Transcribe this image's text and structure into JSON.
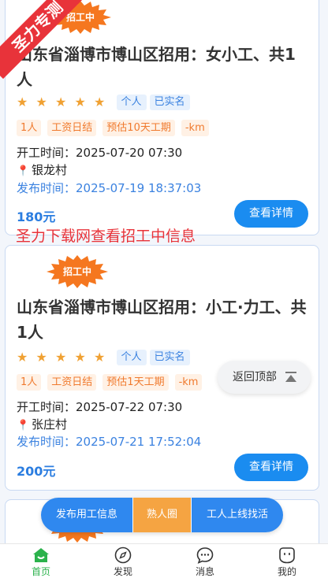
{
  "watermark_corner": "圣力专测",
  "watermark_line": "圣力下载网查看招工中信息",
  "jobs": [
    {
      "badge": "招工中",
      "title": "山东省淄博市博山区招用：女小工、共1人",
      "rating": 5,
      "badges": [
        "个人",
        "已实名"
      ],
      "tags": [
        "1人",
        "工资日结",
        "预估10天工期",
        "-km"
      ],
      "start_label": "开工时间：",
      "start_time": "2025-07-20   07:30",
      "location": "银龙村",
      "publish_label": "发布时间：",
      "publish_time": "2025-07-19   18:37:03",
      "price": "180元",
      "detail_button": "查看详情"
    },
    {
      "badge": "招工中",
      "title": "山东省淄博市博山区招用：小工·力工、共1人",
      "rating": 5,
      "badges": [
        "个人",
        "已实名"
      ],
      "tags": [
        "1人",
        "工资日结",
        "预估1天工期",
        "-km"
      ],
      "start_label": "开工时间：",
      "start_time": "2025-07-22   07:30",
      "location": "张庄村",
      "publish_label": "发布时间：",
      "publish_time": "2025-07-21   17:52:04",
      "price": "200元",
      "detail_button": "查看详情"
    }
  ],
  "back_to_top": "返回顶部",
  "actions": {
    "post": "发布用工信息",
    "acquaintance": "熟人圈",
    "worker_online": "工人上线找活"
  },
  "tabs": [
    {
      "label": "首页",
      "icon": "home-icon",
      "active": true
    },
    {
      "label": "发现",
      "icon": "compass-icon",
      "active": false
    },
    {
      "label": "消息",
      "icon": "message-icon",
      "active": false
    },
    {
      "label": "我的",
      "icon": "profile-icon",
      "active": false
    }
  ],
  "colors": {
    "primary": "#1a8cf0",
    "accent_orange": "#f5a442",
    "badge_orange": "#f5771f",
    "watermark_red": "#e8333a",
    "tab_active": "#2bb24c"
  }
}
